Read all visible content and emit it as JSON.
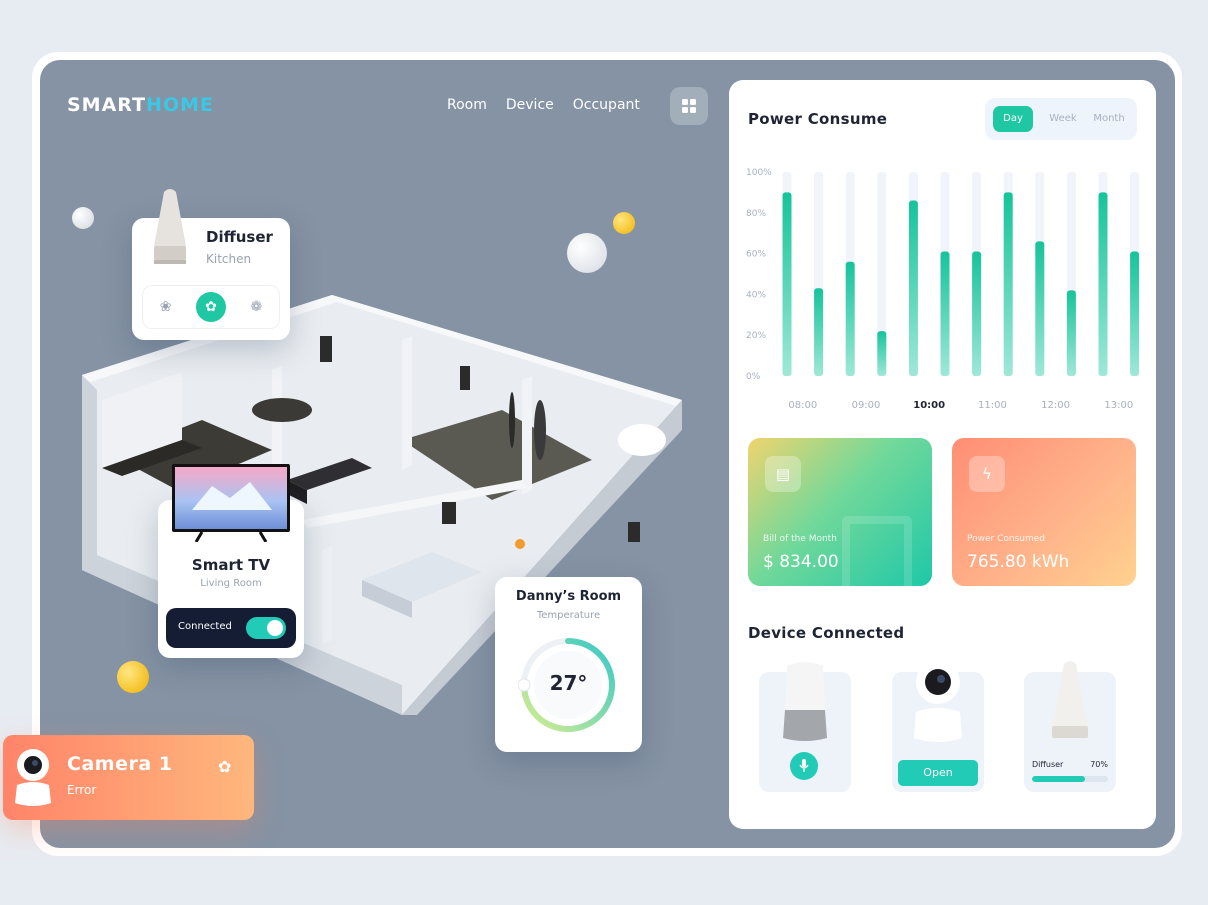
{
  "brand": {
    "name_part1": "SMART",
    "name_part2": "HOME"
  },
  "nav": {
    "items": [
      "Room",
      "Device",
      "Occupant"
    ]
  },
  "diffuser": {
    "title": "Diffuser",
    "location": "Kitchen",
    "modes": [
      "❀",
      "✿",
      "❁"
    ]
  },
  "tv": {
    "title": "Smart TV",
    "location": "Living Room",
    "status": "Connected",
    "on": true
  },
  "room": {
    "title": "Danny’s Room",
    "label": "Temperature",
    "value": "27°",
    "level": 0.75
  },
  "camera": {
    "title": "Camera 1",
    "status": "Error"
  },
  "power": {
    "title": "Power Consume",
    "range_options": [
      "Day",
      "Week",
      "Month"
    ],
    "selected_range": "Day"
  },
  "chart_data": {
    "type": "bar",
    "y_ticks": [
      "100%",
      "80%",
      "60%",
      "40%",
      "20%",
      "0%"
    ],
    "ylim": [
      0,
      100
    ],
    "x_labels": [
      "08:00",
      "09:00",
      "10:00",
      "11:00",
      "12:00",
      "13:00"
    ],
    "highlight_label": "10:00",
    "values": [
      90,
      43,
      56,
      22,
      86,
      61,
      61,
      90,
      66,
      42,
      90,
      61
    ]
  },
  "stats": {
    "bill": {
      "label": "Bill of the Month",
      "value": "$ 834.00"
    },
    "power": {
      "label": "Power Consumed",
      "value": "765.80 kWh"
    }
  },
  "devices": {
    "title": "Device Connected",
    "open_label": "Open",
    "diffuser_name": "Diffuser",
    "diffuser_pct": "70%",
    "diffuser_level": 0.7
  },
  "colors": {
    "accent": "#1fc8a2",
    "navy": "#141d33",
    "stage": "#8593a4"
  }
}
